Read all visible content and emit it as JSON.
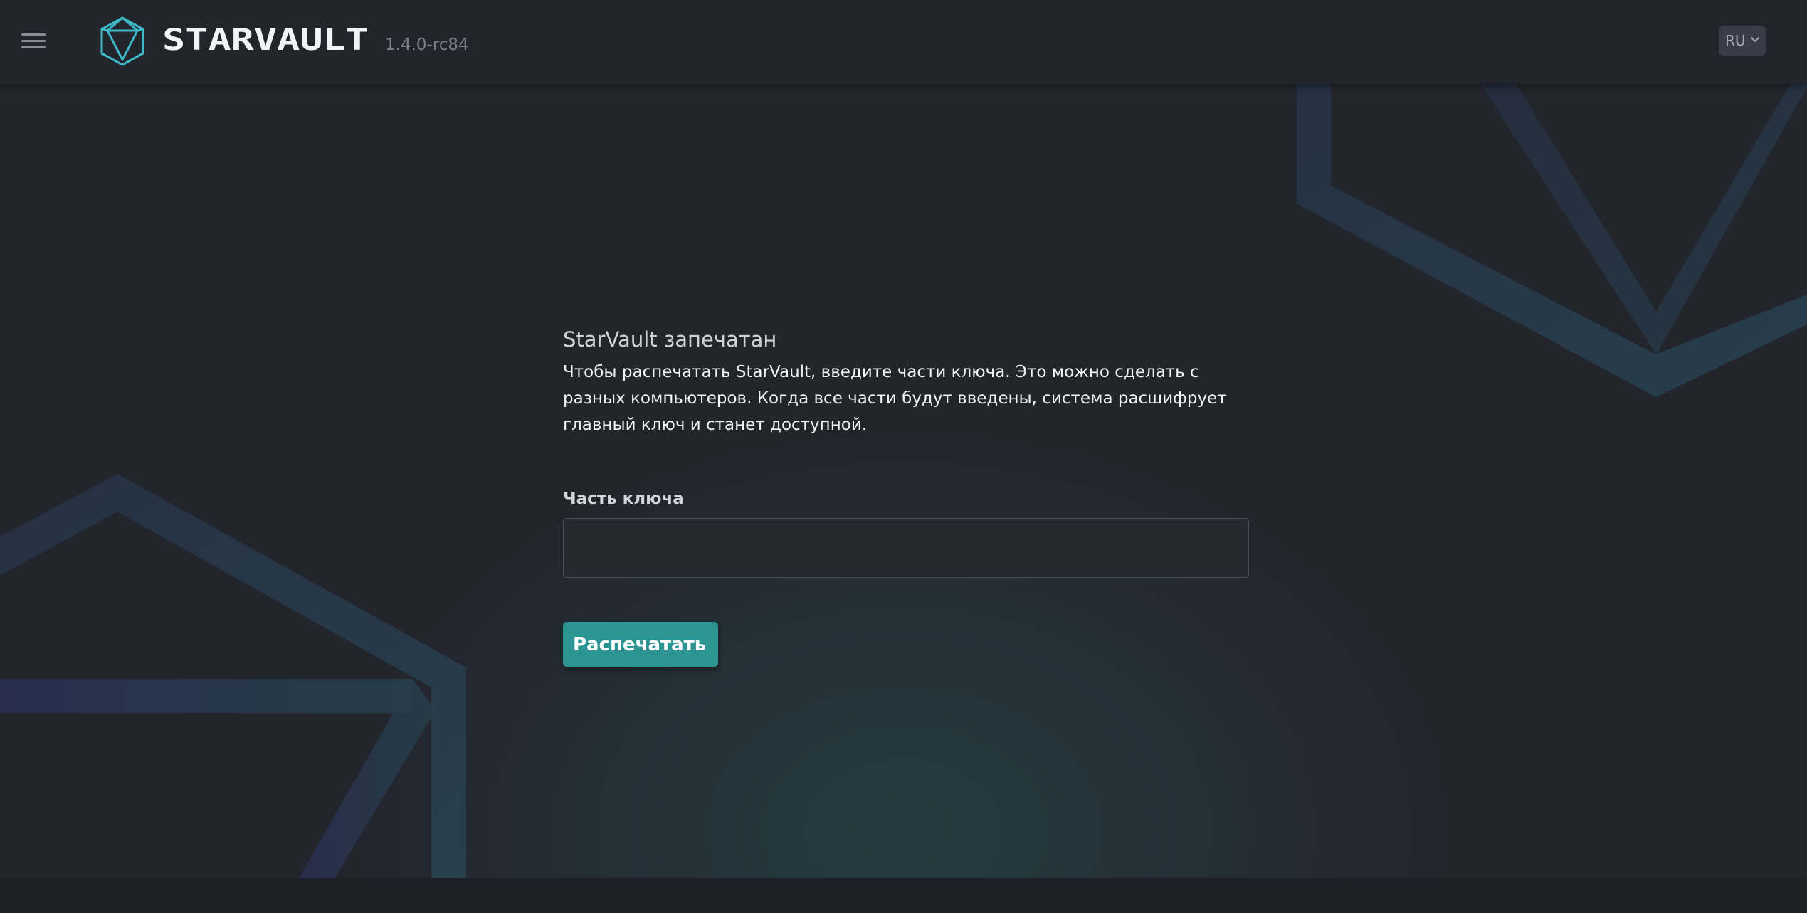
{
  "header": {
    "menu_icon": "hamburger-menu-icon",
    "logo_icon": "starvault-polyhedron-icon",
    "brand": "STARVAULT",
    "version": "1.4.0-rc84",
    "language": {
      "selected": "RU",
      "icon": "chevron-down-icon"
    }
  },
  "unseal": {
    "title": "StarVault запечатан",
    "description": "Чтобы распечатать StarVault, введите части ключа. Это можно сделать с разных компьютеров. Когда все части будут введены, система расшифрует главный ключ и станет доступной.",
    "key_label": "Часть ключа",
    "key_value": "",
    "key_placeholder": "",
    "submit_label": "Распечатать"
  },
  "colors": {
    "background": "#23252d",
    "accent": "#2c9492",
    "logo": "#3fb9c8",
    "decoration": "#2b4a58"
  }
}
